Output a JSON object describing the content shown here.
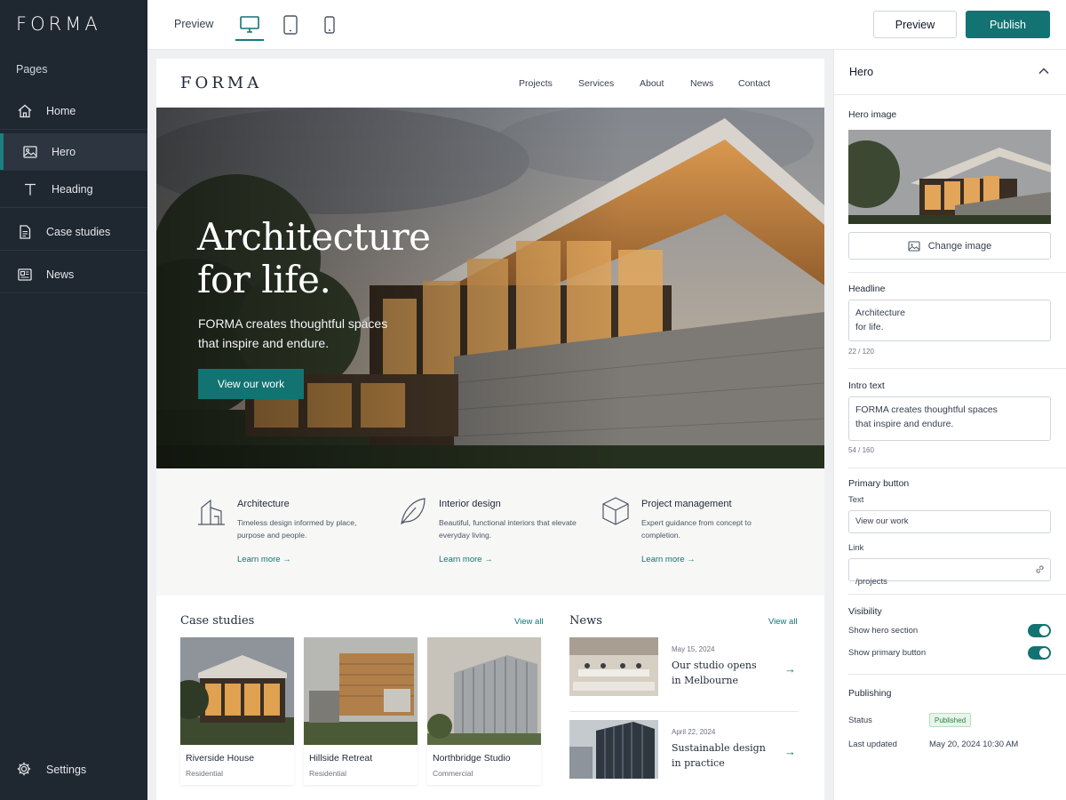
{
  "app": {
    "brand": "FORMA"
  },
  "sidebar": {
    "section_label": "Pages",
    "items": [
      {
        "label": "Home",
        "icon": "home-icon"
      },
      {
        "label": "Hero",
        "icon": "image-icon",
        "active": true
      },
      {
        "label": "Heading",
        "icon": "text-icon"
      },
      {
        "label": "Case studies",
        "icon": "document-icon"
      },
      {
        "label": "News",
        "icon": "newspaper-icon"
      }
    ],
    "settings_label": "Settings"
  },
  "toolbar": {
    "preview_label": "Preview",
    "devices": [
      "desktop",
      "tablet",
      "mobile"
    ],
    "active_device": "desktop",
    "preview_button": "Preview",
    "publish_button": "Publish"
  },
  "site": {
    "brand": "FORMA",
    "nav": [
      "Projects",
      "Services",
      "About",
      "News",
      "Contact"
    ],
    "hero": {
      "title": "Architecture\nfor life.",
      "subtitle": "FORMA creates thoughtful spaces that inspire and endure.",
      "button": "View our work"
    },
    "services": [
      {
        "icon": "building-icon",
        "title": "Architecture",
        "desc": "Timeless design informed by place, purpose and people.",
        "link": "Learn more →"
      },
      {
        "icon": "leaf-icon",
        "title": "Interior design",
        "desc": "Beautiful, functional interiors that elevate everyday living.",
        "link": "Learn more →"
      },
      {
        "icon": "cube-icon",
        "title": "Project management",
        "desc": "Expert guidance from concept to completion.",
        "link": "Learn more →"
      }
    ],
    "case_studies": {
      "title": "Case studies",
      "view_all": "View all",
      "items": [
        {
          "title": "Riverside House",
          "category": "Residential"
        },
        {
          "title": "Hillside Retreat",
          "category": "Residential"
        },
        {
          "title": "Northbridge Studio",
          "category": "Commercial"
        }
      ]
    },
    "news": {
      "title": "News",
      "view_all": "View all",
      "items": [
        {
          "date": "May 15, 2024",
          "title": "Our studio opens\nin Melbourne",
          "arrow": "→"
        },
        {
          "date": "April 22, 2024",
          "title": "Sustainable design\nin practice",
          "arrow": "→"
        }
      ]
    }
  },
  "panel": {
    "title": "Hero",
    "hero_image_label": "Hero image",
    "change_image": "Change image",
    "headline_label": "Headline",
    "headline_value": "Architecture\nfor life.",
    "headline_count": "22 / 120",
    "intro_label": "Intro text",
    "intro_value": "FORMA creates thoughtful spaces\nthat inspire and endure.",
    "intro_count": "54 / 160",
    "primary_button_label": "Primary button",
    "text_label": "Text",
    "text_value": "View our work",
    "link_label": "Link",
    "link_value": "/projects",
    "visibility_label": "Visibility",
    "show_hero_label": "Show hero section",
    "show_hero_value": true,
    "show_button_label": "Show primary button",
    "show_button_value": true,
    "publishing_label": "Publishing",
    "status_label": "Status",
    "status_value": "Published",
    "updated_label": "Last updated",
    "updated_value": "May 20, 2024  10:30 AM"
  },
  "colors": {
    "sidebar_bg": "#1f2731",
    "accent": "#137372",
    "published_badge": "#e7f5ea"
  }
}
